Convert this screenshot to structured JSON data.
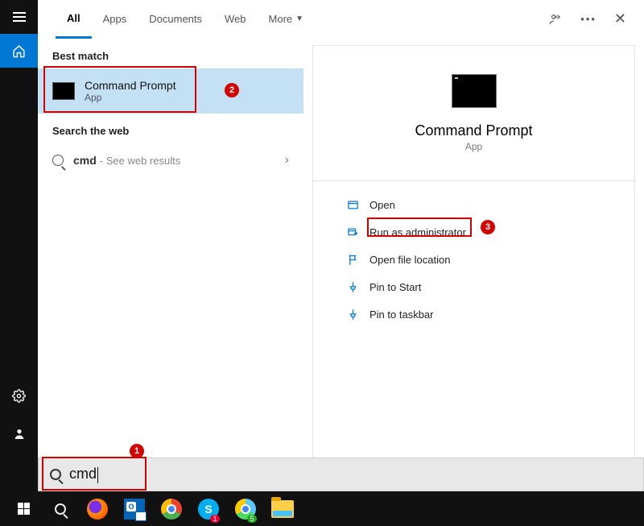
{
  "tabs": {
    "all": "All",
    "apps": "Apps",
    "documents": "Documents",
    "web": "Web",
    "more": "More"
  },
  "sections": {
    "best_match": "Best match",
    "search_web": "Search the web"
  },
  "best_match": {
    "title": "Command Prompt",
    "subtitle": "App"
  },
  "web_result": {
    "query": "cmd",
    "suffix": " - See web results"
  },
  "detail": {
    "title": "Command Prompt",
    "subtitle": "App"
  },
  "actions": {
    "open": "Open",
    "run_admin": "Run as administrator",
    "open_location": "Open file location",
    "pin_start": "Pin to Start",
    "pin_taskbar": "Pin to taskbar"
  },
  "search": {
    "value": "cmd"
  },
  "annotations": {
    "n1": "1",
    "n2": "2",
    "n3": "3"
  }
}
